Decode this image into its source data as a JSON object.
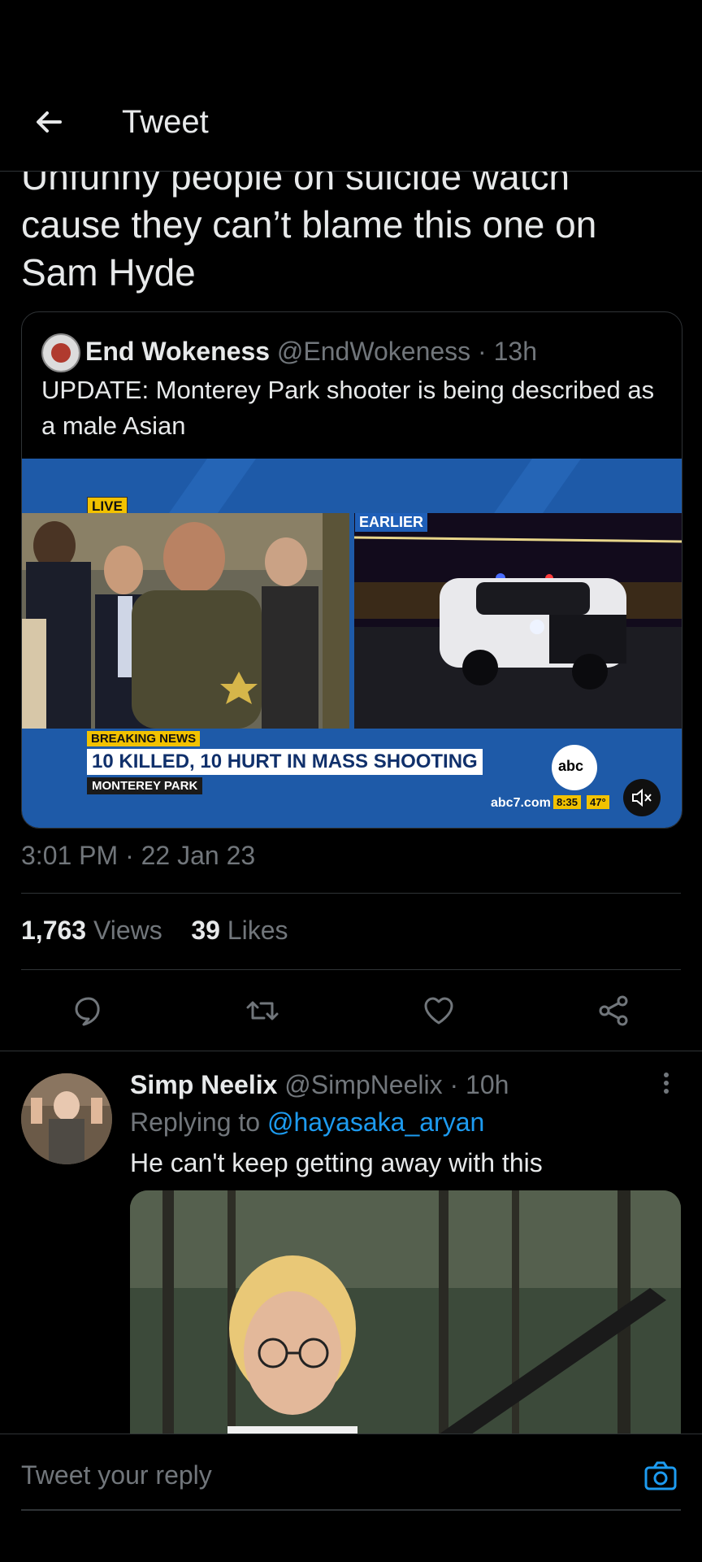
{
  "header": {
    "title": "Tweet"
  },
  "tweet": {
    "text": "Unfunny people on suicide watch cause they can’t blame this one on Sam Hyde",
    "timestamp": "3:01 PM · 22 Jan 23",
    "stats": {
      "views_count": "1,763",
      "views_label": "Views",
      "likes_count": "39",
      "likes_label": "Likes"
    }
  },
  "quote": {
    "name": "End Wokeness",
    "handle": "@EndWokeness",
    "separator": "·",
    "time": "13h",
    "text": "UPDATE: Monterey Park shooter is being described as a male Asian",
    "media": {
      "live": "LIVE",
      "earlier": "EARLIER",
      "breaking": "BREAKING NEWS",
      "headline": "10 KILLED, 10 HURT IN MASS SHOOTING",
      "location": "MONTEREY PARK",
      "logo": "abc",
      "url": "abc7.com",
      "clock": "8:35",
      "temp": "47°"
    }
  },
  "reply": {
    "name": "Simp Neelix",
    "handle": "@SimpNeelix",
    "separator": "·",
    "time": "10h",
    "replying_prefix": "Replying to",
    "replying_to": "@hayasaka_aryan",
    "text": "He can't keep getting away with this"
  },
  "compose": {
    "placeholder": "Tweet your reply"
  },
  "colors": {
    "background": "#000000",
    "text": "#e7e9ea",
    "secondary": "#71767b",
    "accent": "#1d9bf0",
    "border": "#2f3336"
  }
}
